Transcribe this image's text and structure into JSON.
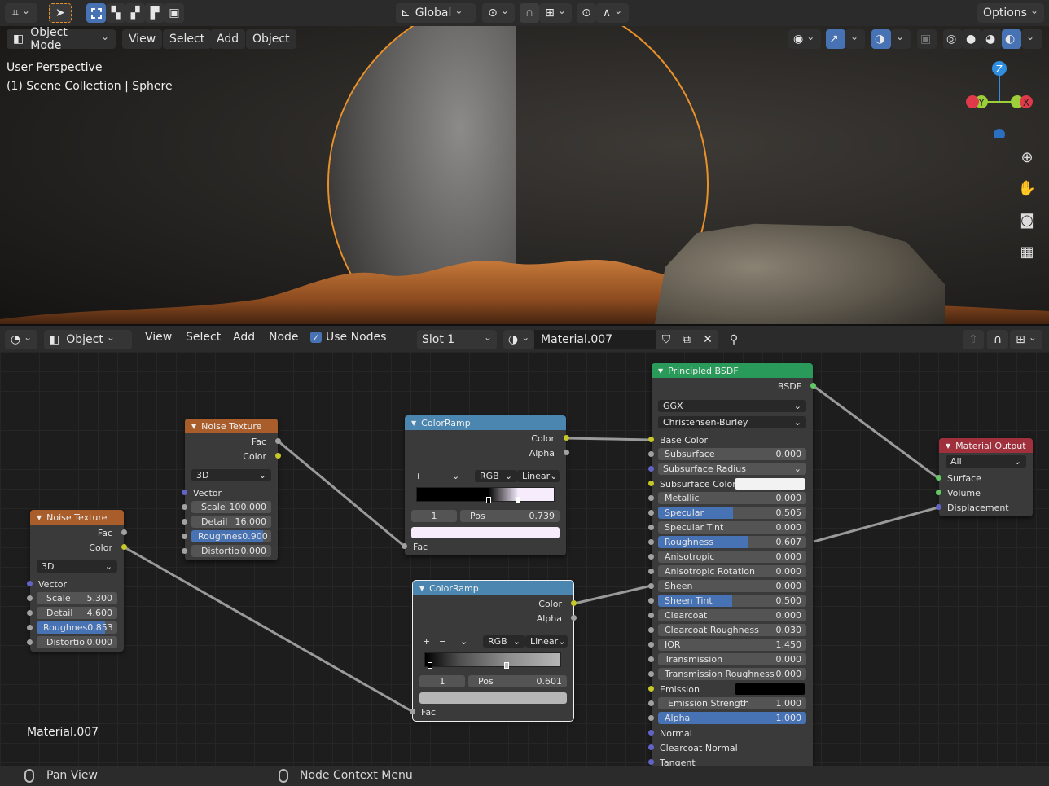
{
  "top_bar": {
    "transform_orientation": "Global",
    "options_label": "Options"
  },
  "viewport": {
    "mode": "Object Mode",
    "menus": [
      "View",
      "Select",
      "Add",
      "Object"
    ],
    "perspective_label": "User Perspective",
    "collection_label": "(1) Scene Collection | Sphere",
    "gizmo_axes": [
      "Z",
      "Y",
      "X"
    ]
  },
  "node_header": {
    "object_type": "Object",
    "menus": [
      "View",
      "Select",
      "Add",
      "Node"
    ],
    "use_nodes_label": "Use Nodes",
    "slot": "Slot 1",
    "material": "Material.007"
  },
  "nodes": {
    "noise1": {
      "title": "Noise Texture",
      "outputs": [
        "Fac",
        "Color"
      ],
      "dimension": "3D",
      "vector_label": "Vector",
      "fields": [
        {
          "label": "Scale",
          "value": "5.300"
        },
        {
          "label": "Detail",
          "value": "4.600"
        },
        {
          "label": "Roughnes",
          "value": "0.853"
        },
        {
          "label": "Distortio",
          "value": "0.000"
        }
      ]
    },
    "noise2": {
      "title": "Noise Texture",
      "outputs": [
        "Fac",
        "Color"
      ],
      "dimension": "3D",
      "vector_label": "Vector",
      "fields": [
        {
          "label": "Scale",
          "value": "100.000"
        },
        {
          "label": "Detail",
          "value": "16.000"
        },
        {
          "label": "Roughnes",
          "value": "0.900"
        },
        {
          "label": "Distortio",
          "value": "0.000"
        }
      ]
    },
    "ramp1": {
      "title": "ColorRamp",
      "outputs": [
        "Color",
        "Alpha"
      ],
      "mode": "RGB",
      "interp": "Linear",
      "index": "1",
      "pos_label": "Pos",
      "pos_value": "0.739",
      "input": "Fac"
    },
    "ramp2": {
      "title": "ColorRamp",
      "outputs": [
        "Color",
        "Alpha"
      ],
      "mode": "RGB",
      "interp": "Linear",
      "index": "1",
      "pos_label": "Pos",
      "pos_value": "0.601",
      "input": "Fac"
    },
    "bsdf": {
      "title": "Principled BSDF",
      "output": "BSDF",
      "distribution": "GGX",
      "subsurface_method": "Christensen-Burley",
      "base_color": "Base Color",
      "subsurface": {
        "label": "Subsurface",
        "value": "0.000"
      },
      "subsurface_radius": "Subsurface Radius",
      "subsurface_color": "Subsurface Color",
      "fields": [
        {
          "label": "Metallic",
          "value": "0.000",
          "fill": 0
        },
        {
          "label": "Specular",
          "value": "0.505",
          "fill": 0.505
        },
        {
          "label": "Specular Tint",
          "value": "0.000",
          "fill": 0
        },
        {
          "label": "Roughness",
          "value": "0.607",
          "fill": 0.607
        },
        {
          "label": "Anisotropic",
          "value": "0.000",
          "fill": 0
        },
        {
          "label": "Anisotropic Rotation",
          "value": "0.000",
          "fill": 0
        },
        {
          "label": "Sheen",
          "value": "0.000",
          "fill": 0
        },
        {
          "label": "Sheen Tint",
          "value": "0.500",
          "fill": 0.5
        },
        {
          "label": "Clearcoat",
          "value": "0.000",
          "fill": 0
        },
        {
          "label": "Clearcoat Roughness",
          "value": "0.030",
          "fill": 0.03
        },
        {
          "label": "IOR",
          "value": "1.450",
          "fill": 0
        },
        {
          "label": "Transmission",
          "value": "0.000",
          "fill": 0
        },
        {
          "label": "Transmission Roughness",
          "value": "0.000",
          "fill": 0
        }
      ],
      "emission": "Emission",
      "emission_strength": {
        "label": "Emission Strength",
        "value": "1.000"
      },
      "alpha": {
        "label": "Alpha",
        "value": "1.000",
        "fill": 1
      },
      "vector_inputs": [
        "Normal",
        "Clearcoat Normal",
        "Tangent"
      ]
    },
    "output": {
      "title": "Material Output",
      "target": "All",
      "inputs": [
        "Surface",
        "Volume",
        "Displacement"
      ]
    }
  },
  "canvas_label": "Material.007",
  "status_bar": {
    "left": "Pan View",
    "right": "Node Context Menu"
  },
  "colors": {
    "accent": "#4772b3",
    "texture_header": "#a85d2a",
    "converter_header": "#4a86b0",
    "shader_header": "#2a9a5a",
    "output_header": "#a0303c",
    "selection_outline": "#e8912a"
  }
}
